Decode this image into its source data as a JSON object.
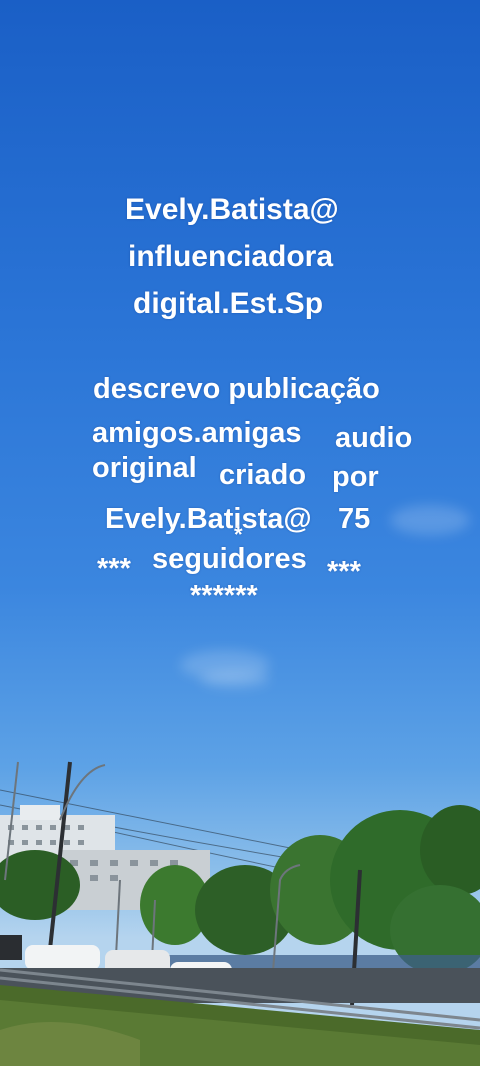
{
  "overlay": {
    "line1": "Evely.Batista@",
    "line2": "influenciadora",
    "line3": "digital.Est.Sp",
    "line4": "descrevo publicação",
    "line5a": "amigos.amigas",
    "line5b": "audio",
    "line6a": "original",
    "line6b": "criado",
    "line6c": "por",
    "line7a": "Evely.Batista@",
    "line7b": "75",
    "line8a": "***",
    "line8b": "seguidores",
    "line8c": "***",
    "line9": "******",
    "stray": "*"
  },
  "colors": {
    "sky_top": "#1a5fc6",
    "sky_bottom": "#b5d4ee",
    "text": "#ffffff",
    "trees": "#2f6b2a"
  }
}
